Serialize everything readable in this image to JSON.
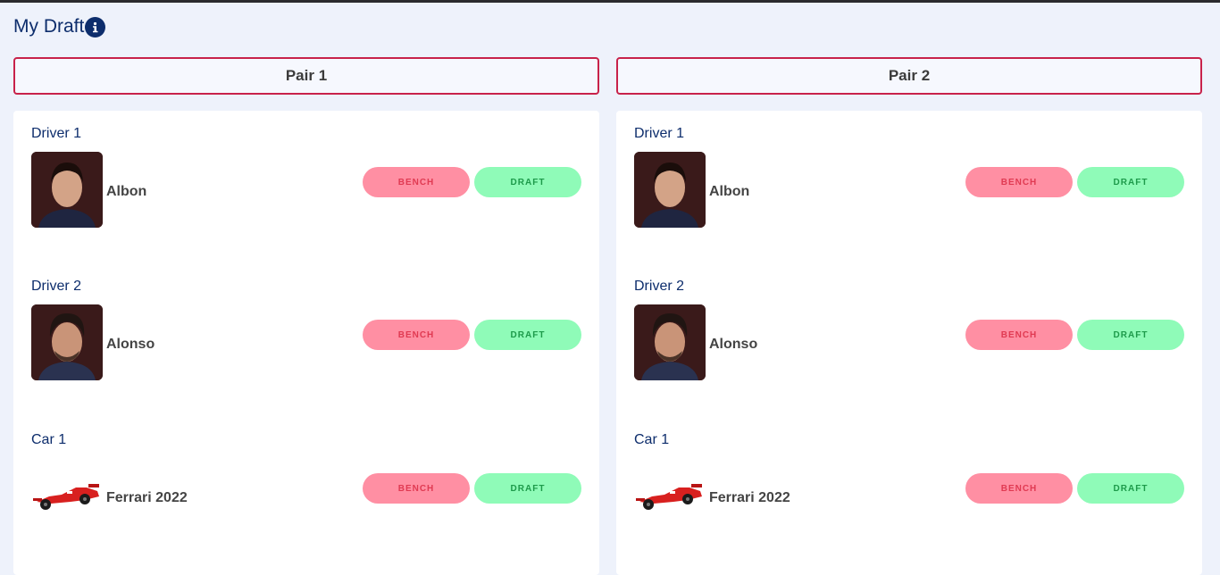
{
  "header": {
    "title": "My Draft",
    "info_icon": "info-icon"
  },
  "pairs": [
    {
      "label": "Pair 1",
      "slots": [
        {
          "title": "Driver 1",
          "name": "Albon",
          "type": "driver",
          "bench_label": "BENCH",
          "draft_label": "DRAFT"
        },
        {
          "title": "Driver 2",
          "name": "Alonso",
          "type": "driver",
          "bench_label": "BENCH",
          "draft_label": "DRAFT"
        },
        {
          "title": "Car 1",
          "name": "Ferrari 2022",
          "type": "car",
          "bench_label": "BENCH",
          "draft_label": "DRAFT"
        }
      ]
    },
    {
      "label": "Pair 2",
      "slots": [
        {
          "title": "Driver 1",
          "name": "Albon",
          "type": "driver",
          "bench_label": "BENCH",
          "draft_label": "DRAFT"
        },
        {
          "title": "Driver 2",
          "name": "Alonso",
          "type": "driver",
          "bench_label": "BENCH",
          "draft_label": "DRAFT"
        },
        {
          "title": "Car 1",
          "name": "Ferrari 2022",
          "type": "car",
          "bench_label": "BENCH",
          "draft_label": "DRAFT"
        }
      ]
    }
  ],
  "colors": {
    "accent_border": "#c8224a",
    "title_navy": "#0d2d6c",
    "bench_bg": "#ff8fa3",
    "draft_bg": "#8ffbb8"
  }
}
